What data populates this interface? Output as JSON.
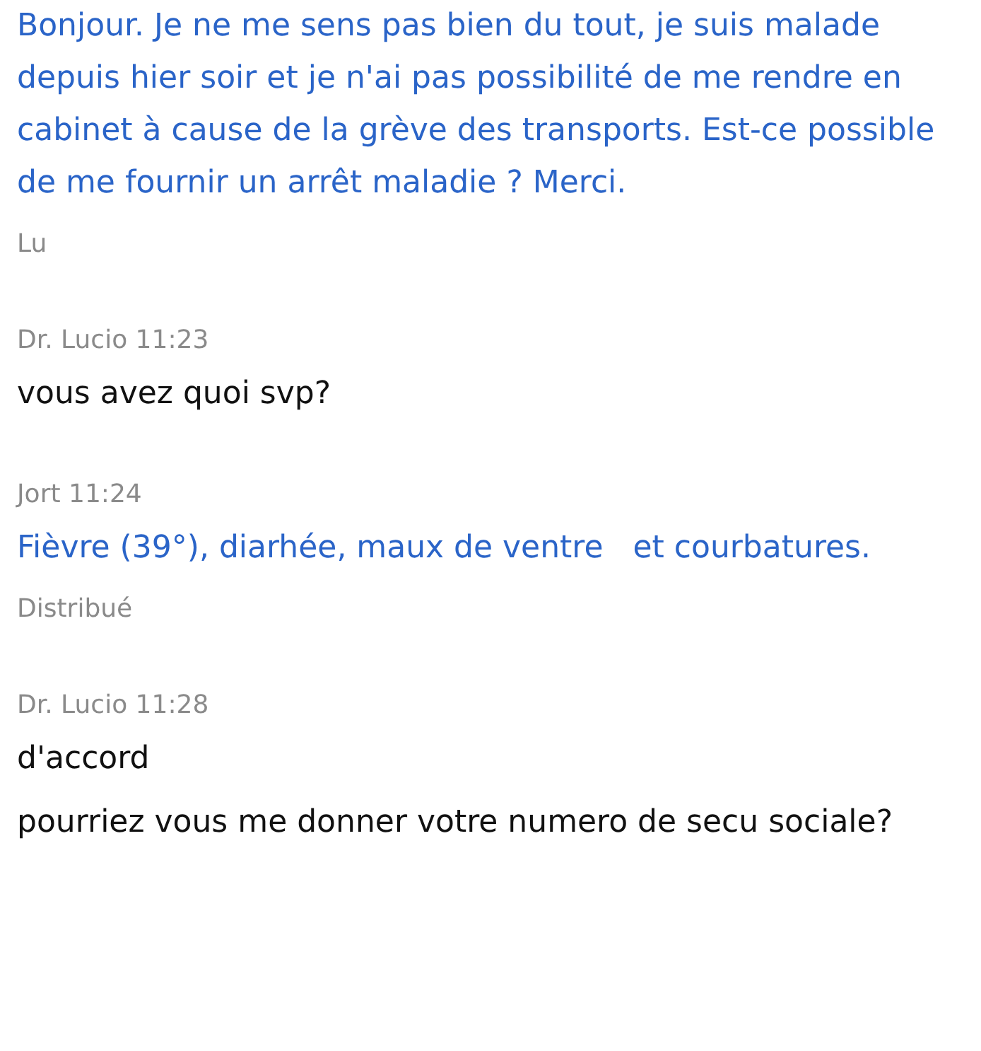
{
  "messages": [
    {
      "kind": "sent",
      "bubbles": [
        "Bonjour. Je ne me sens pas bien du tout, je suis malade depuis hier soir et je n'ai pas possibilité de me rendre en cabinet à cause de la grève des transports. Est-ce possible de me fournir un arrêt maladie ? Merci."
      ],
      "status": "Lu"
    },
    {
      "kind": "received",
      "header": "Dr. Lucio 11:23",
      "bubbles": [
        "vous avez quoi svp?"
      ]
    },
    {
      "kind": "sent",
      "header": "Jort 11:24",
      "bubbles": [
        "Fièvre (39°), diarhée, maux de ventre   et courbatures."
      ],
      "status": "Distribué"
    },
    {
      "kind": "received",
      "header": "Dr. Lucio 11:28",
      "bubbles": [
        "d'accord",
        "pourriez vous me donner votre numero de secu sociale?"
      ]
    }
  ]
}
